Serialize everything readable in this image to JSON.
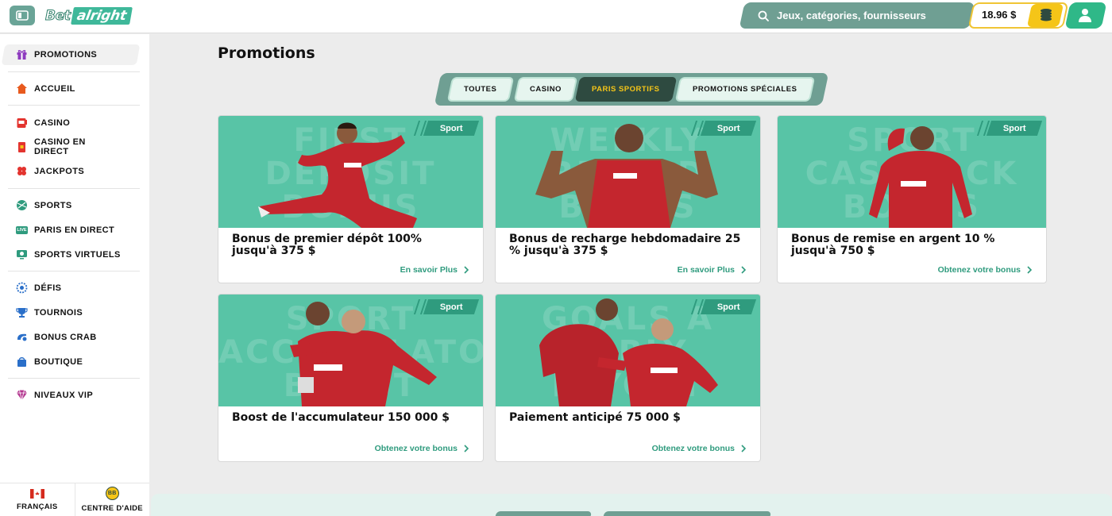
{
  "header": {
    "logo_bet": "Bet",
    "logo_alright": "alright",
    "search_placeholder": "Jeux, catégories, fournisseurs",
    "balance": "18.96 $"
  },
  "sidebar": {
    "items": [
      {
        "label": "PROMOTIONS",
        "icon": "gift-icon"
      },
      {
        "label": "ACCUEIL",
        "icon": "home-icon"
      },
      {
        "label": "CASINO",
        "icon": "slot-machine-icon"
      },
      {
        "label": "CASINO EN DIRECT",
        "icon": "live-cards-icon"
      },
      {
        "label": "JACKPOTS",
        "icon": "clover-icon"
      },
      {
        "label": "SPORTS",
        "icon": "ball-icon"
      },
      {
        "label": "PARIS EN DIRECT",
        "icon": "live-badge-icon"
      },
      {
        "label": "SPORTS VIRTUELS",
        "icon": "virtual-sports-icon"
      },
      {
        "label": "DÉFIS",
        "icon": "challenge-icon"
      },
      {
        "label": "TOURNOIS",
        "icon": "trophy-icon"
      },
      {
        "label": "BONUS CRAB",
        "icon": "crab-icon"
      },
      {
        "label": "BOUTIQUE",
        "icon": "shop-icon"
      },
      {
        "label": "NIVEAUX VIP",
        "icon": "diamond-icon"
      }
    ],
    "live_badge": "LIVE",
    "footer": {
      "language": "FRANÇAIS",
      "help": "CENTRE D'AIDE",
      "help_badge": "BB"
    }
  },
  "main": {
    "title": "Promotions",
    "tabs": [
      {
        "label": "TOUTES",
        "active": false
      },
      {
        "label": "CASINO",
        "active": false
      },
      {
        "label": "PARIS SPORTIFS",
        "active": true
      },
      {
        "label": "PROMOTIONS SPÉCIALES",
        "active": false
      }
    ],
    "cards": [
      {
        "badge": "Sport",
        "title": "Bonus de premier dépôt 100% jusqu'à 375 $",
        "link": "En savoir Plus",
        "bg_lines": [
          "FIRST",
          "DEPOSIT",
          "BONUS"
        ]
      },
      {
        "badge": "Sport",
        "title": "Bonus de recharge hebdomadaire 25 % jusqu'à 375 $",
        "link": "En savoir Plus",
        "bg_lines": [
          "WEEKLY",
          "RELOAD",
          "BONUS"
        ]
      },
      {
        "badge": "Sport",
        "title": "Bonus de remise en argent 10 % jusqu'à 750 $",
        "link": "Obtenez votre bonus",
        "bg_lines": [
          "SPORT",
          "CASHBACK",
          "BONUS"
        ]
      },
      {
        "badge": "Sport",
        "title": "Boost de l'accumulateur 150 000 $",
        "link": "Obtenez votre bonus",
        "bg_lines": [
          "SPORT",
          "ACCUMULATOR",
          "BOOST"
        ]
      },
      {
        "badge": "Sport",
        "title": "Paiement anticipé 75 000 $",
        "link": "Obtenez votre bonus",
        "bg_lines": [
          "GOALS A",
          "EARLY",
          "PAYOUT"
        ]
      }
    ]
  },
  "colors": {
    "brand_green": "#2f9b7e",
    "card_image_bg": "#58c4a6",
    "tab_active_bg": "#2e4a40",
    "tab_active_text": "#f5c518",
    "jersey_red": "#c4262e"
  }
}
